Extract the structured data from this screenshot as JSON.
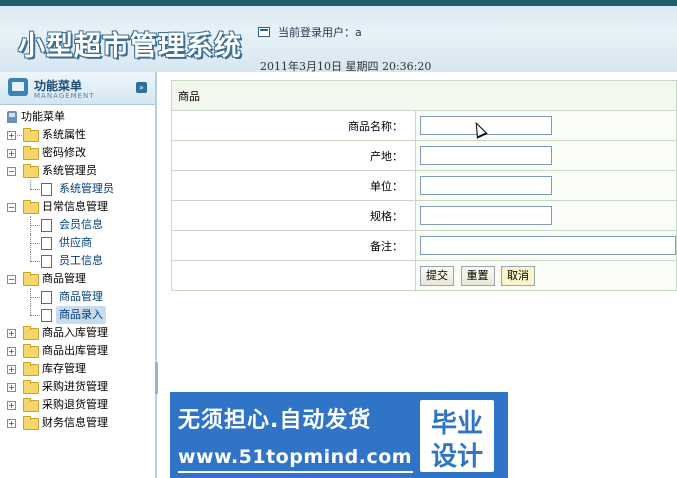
{
  "header": {
    "system_title": "小型超市管理系统",
    "current_user_label": "当前登录用户：a",
    "datetime": "2011年3月10日  星期四  20:36:20"
  },
  "sidebar": {
    "menu_title": "功能菜单",
    "menu_subtitle": "MANAGEMENT",
    "tree_root": "功能菜单",
    "items": [
      {
        "label": "系统属性"
      },
      {
        "label": "密码修改"
      },
      {
        "label": "系统管理员",
        "children": [
          {
            "label": "系统管理员"
          }
        ]
      },
      {
        "label": "日常信息管理",
        "children": [
          {
            "label": "会员信息"
          },
          {
            "label": "供应商"
          },
          {
            "label": "员工信息"
          }
        ]
      },
      {
        "label": "商品管理",
        "children": [
          {
            "label": "商品管理"
          },
          {
            "label": "商品录入"
          }
        ]
      },
      {
        "label": "商品入库管理"
      },
      {
        "label": "商品出库管理"
      },
      {
        "label": "库存管理"
      },
      {
        "label": "采购进货管理"
      },
      {
        "label": "采购退货管理"
      },
      {
        "label": "财务信息管理"
      }
    ]
  },
  "form": {
    "title": "商品",
    "fields": [
      {
        "label": "商品名称：",
        "value": ""
      },
      {
        "label": "产地：",
        "value": ""
      },
      {
        "label": "单位：",
        "value": ""
      },
      {
        "label": "规格：",
        "value": ""
      },
      {
        "label": "备注：",
        "value": ""
      }
    ],
    "buttons": {
      "submit": "提交",
      "reset": "重置",
      "cancel": "取消"
    }
  },
  "banner": {
    "main_text": "无须担心.自动发货",
    "url": "www.51topmind.com",
    "badge_line1": "毕业",
    "badge_line2": "设计"
  }
}
